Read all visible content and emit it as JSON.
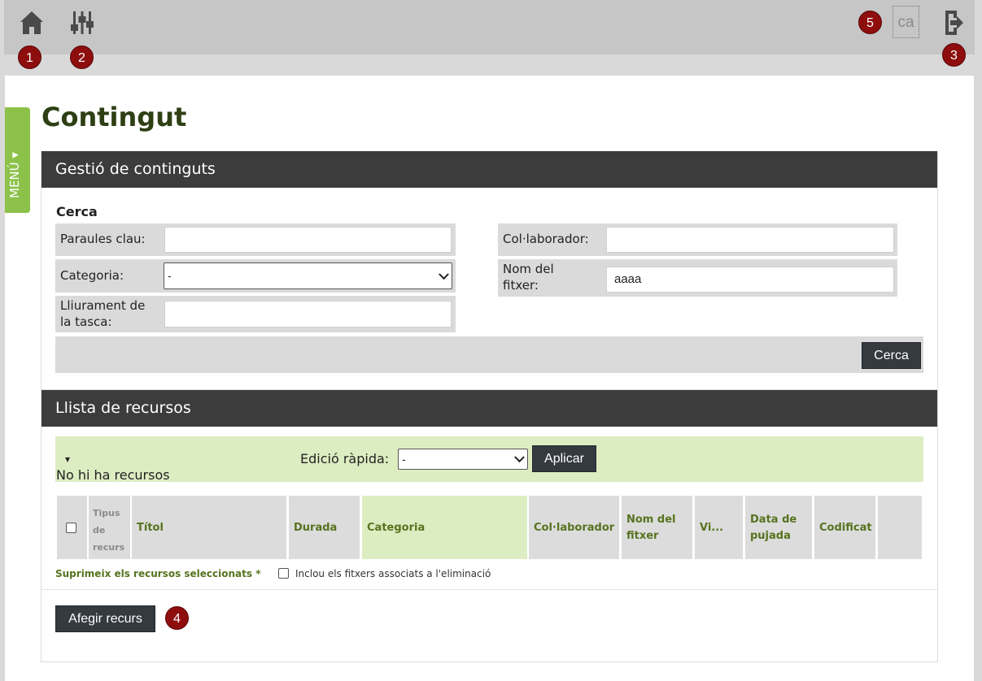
{
  "topbar": {
    "language": "ca",
    "badges": [
      "1",
      "2",
      "3",
      "4",
      "5"
    ]
  },
  "sidebar": {
    "menu_label": "MENÚ ▾"
  },
  "page": {
    "title": "Contingut"
  },
  "management": {
    "header": "Gestió de continguts",
    "search_heading": "Cerca",
    "fields": {
      "keywords": {
        "label": "Paraules clau:",
        "value": ""
      },
      "category": {
        "label": "Categoria:",
        "value": "-"
      },
      "task_delivery_line1": "Lliurament de",
      "task_delivery_line2": "la tasca:",
      "task_delivery_value": "",
      "collaborator": {
        "label": "Col·laborador:",
        "value": ""
      },
      "filename_line1": "Nom del",
      "filename_line2": "fitxer:",
      "filename_value": "aaaa"
    },
    "search_button": "Cerca"
  },
  "resources": {
    "header": "Llista de recursos",
    "toggle": "▾",
    "empty_message": "No hi ha recursos",
    "quick_edit_label": "Edició ràpida:",
    "quick_edit_value": "-",
    "apply_button": "Aplicar",
    "columns": {
      "type_l1": "Tipus",
      "type_l2": "de",
      "type_l3": "recurs",
      "title": "Títol",
      "duration": "Durada",
      "category": "Categoria",
      "collaborator": "Col·laborador",
      "filename_l1": "Nom del",
      "filename_l2": "fitxer",
      "views": "Vi...",
      "upload_l1": "Data de",
      "upload_l2": "pujada",
      "encoded": "Codificat"
    },
    "delete_selected": "Suprimeix els recursos seleccionats *",
    "include_files_label": "Inclou els fitxers associats a l'eliminació",
    "add_button": "Afegir recurs"
  },
  "colors": {
    "accent_green": "#8cc24a",
    "light_green": "#ddedc2",
    "header_dark": "#3c3c3c",
    "badge_red": "#8e0e0e",
    "title_green": "#2e3f14"
  }
}
